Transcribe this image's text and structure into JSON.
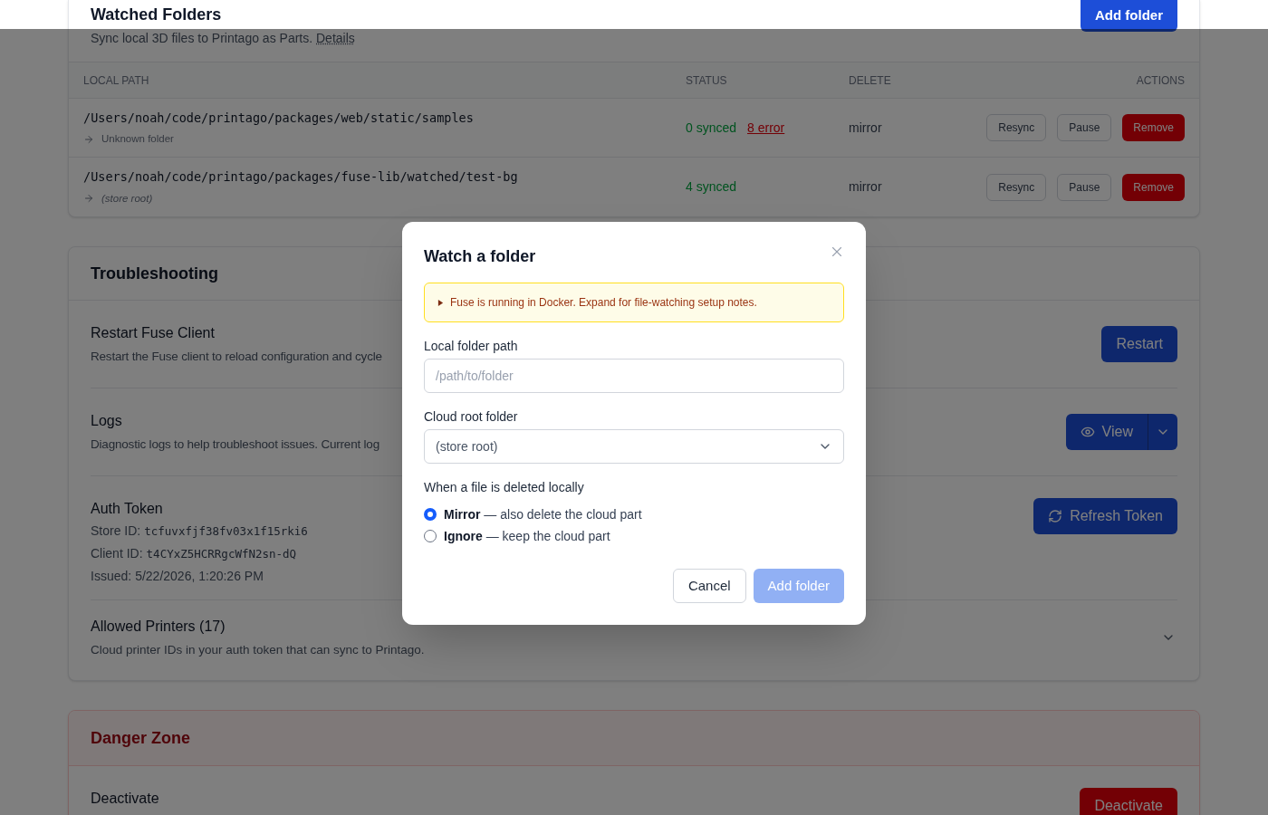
{
  "watched_folders": {
    "title": "Watched Folders",
    "subtitle": "Sync local 3D files to Printago as Parts.",
    "details_link": "Details",
    "add_button": "Add folder",
    "table": {
      "columns": [
        "LOCAL PATH",
        "STATUS",
        "DELETE",
        "ACTIONS"
      ],
      "rows": [
        {
          "path": "/Users/noah/code/printago/packages/web/static/samples",
          "target": {
            "text": "Unknown folder",
            "kind": "folder"
          },
          "status": [
            {
              "text": "0 synced",
              "kind": "synced"
            },
            {
              "text": "8 error",
              "kind": "error"
            }
          ],
          "delete_mode": "mirror",
          "actions": [
            {
              "label": "Resync",
              "kind": "outline"
            },
            {
              "label": "Pause",
              "kind": "outline"
            },
            {
              "label": "Remove",
              "kind": "danger"
            }
          ]
        },
        {
          "path": "/Users/noah/code/printago/packages/fuse-lib/watched/test-bg",
          "target": {
            "text": "(store root)",
            "kind": "root"
          },
          "status": [
            {
              "text": "4 synced",
              "kind": "synced"
            }
          ],
          "delete_mode": "mirror",
          "actions": [
            {
              "label": "Resync",
              "kind": "outline"
            },
            {
              "label": "Pause",
              "kind": "outline"
            },
            {
              "label": "Remove",
              "kind": "danger"
            }
          ]
        }
      ]
    }
  },
  "troubleshooting": {
    "title": "Troubleshooting",
    "sections": [
      {
        "kind": "action",
        "title": "Restart Fuse Client",
        "description": "Restart the Fuse client to reload configuration and cycle",
        "button": "Restart"
      },
      {
        "kind": "split",
        "title": "Logs",
        "description": "Diagnostic logs to help troubleshoot issues. Current log",
        "button": "View"
      },
      {
        "kind": "token",
        "title": "Auth Token",
        "fields": [
          {
            "label": "Store ID:",
            "value": "tcfuvxfjf38fv03x1f15rki6",
            "kind": "code"
          },
          {
            "label": "Client ID:",
            "value": "t4CYxZ5HCRRgcWfN2sn-dQ",
            "kind": "code"
          },
          {
            "label": "Issued:",
            "value": "5/22/2026, 1:20:26 PM",
            "kind": "text"
          }
        ],
        "button": "Refresh Token"
      },
      {
        "kind": "collapsible",
        "title": "Allowed Printers (17)",
        "description": "Cloud printer IDs in your auth token that can sync to Printago.",
        "expanded": false
      }
    ]
  },
  "danger_zone": {
    "title": "Danger Zone",
    "items": [
      {
        "title": "Deactivate",
        "button": "Deactivate"
      }
    ]
  },
  "dialog": {
    "title": "Watch a folder",
    "notice": {
      "text": "Fuse is running in Docker. Expand for file-watching setup notes.",
      "expanded": false
    },
    "local_path": {
      "label": "Local folder path",
      "placeholder": "/path/to/folder"
    },
    "cloud_root": {
      "label": "Cloud root folder",
      "value": "(store root)"
    },
    "delete_behavior": {
      "label": "When a file is deleted locally",
      "options": [
        {
          "label": "**Mirror** — also delete the cloud part",
          "selected": true
        },
        {
          "label": "**Ignore** — keep the cloud part",
          "selected": false
        }
      ]
    },
    "buttons": [
      {
        "label": "Cancel",
        "kind": "secondary",
        "disabled": false
      },
      {
        "label": "Add folder",
        "kind": "primary",
        "disabled": true
      }
    ]
  }
}
